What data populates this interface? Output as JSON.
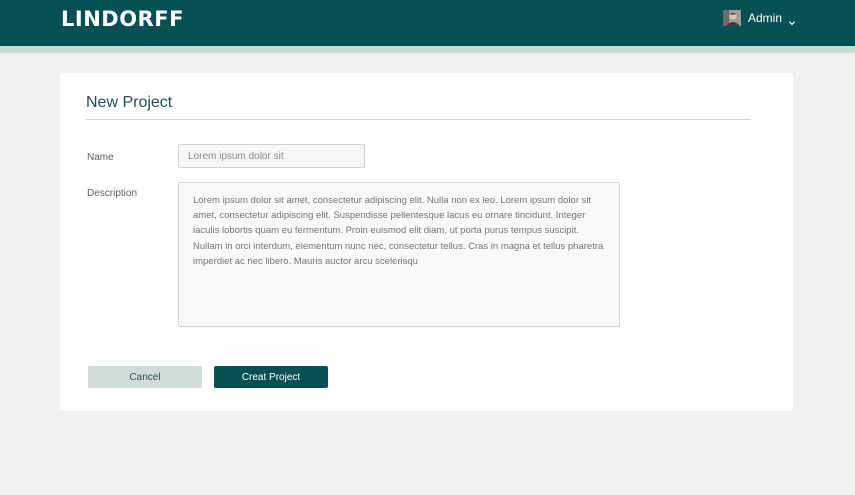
{
  "header": {
    "logo_text": "LINDORFF",
    "user_name": "Admin"
  },
  "form": {
    "title": "New Project",
    "name_label": "Name",
    "name_placeholder": "Lorem ipsum dolor sit",
    "description_label": "Description",
    "description_value": "Lorem ipsum dolor sit amet, consectetur adipiscing elit. Nulla non ex leo. Lorem ipsum dolor sit amet, consectetur adipiscing elit. Suspendisse pellentesque lacus eu ornare tincidunt. Integer iaculis lobortis quam eu fermentum. Proin euismod elit diam, ut porta purus tempus suscipit. Nullam in orci interdum, elementum nunc nec, consectetur tellus. Cras in magna et tellus pharetra imperdiet ac nec libero. Mauris auctor arcu scelerisqu",
    "cancel_label": "Cancel",
    "create_label": "Creat Project"
  },
  "colors": {
    "header_bg": "#064f55",
    "header_strip": "#c9d9d4",
    "primary_button": "#064f55",
    "secondary_button": "#cfdcd9",
    "page_bg": "#f1f1f1"
  },
  "icons": {
    "avatar": "user-avatar",
    "dropdown": "chevron-down-icon"
  }
}
